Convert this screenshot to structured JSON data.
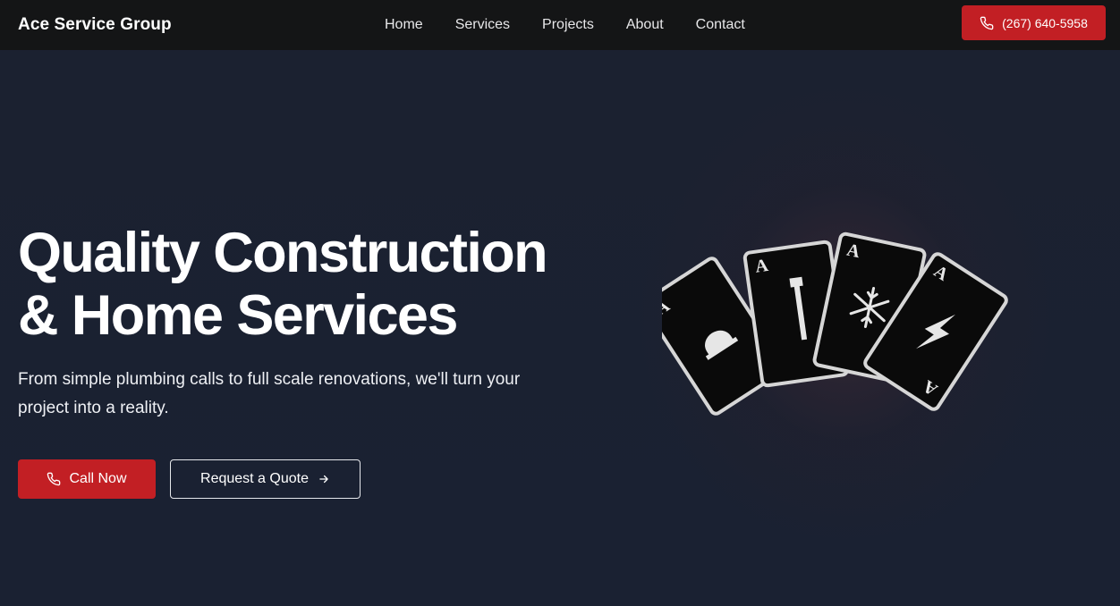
{
  "nav": {
    "brand": "Ace Service Group",
    "links": [
      "Home",
      "Services",
      "Projects",
      "About",
      "Contact"
    ],
    "phone_label": "(267) 640-5958",
    "phone_icon": "phone-icon"
  },
  "hero": {
    "title_line1": "Quality Construction",
    "title_line2": "& Home Services",
    "subtitle": "From simple plumbing calls to full scale renovations, we'll turn your project into a reality.",
    "call_button": "Call Now",
    "quote_button": "Request a Quote",
    "quote_icon": "arrow-right-icon",
    "cards_image": "ace-cards-logo",
    "card_letter": "A"
  },
  "colors": {
    "accent": "#c21f24",
    "navbar_bg": "#141516",
    "hero_bg": "#1a2132"
  }
}
